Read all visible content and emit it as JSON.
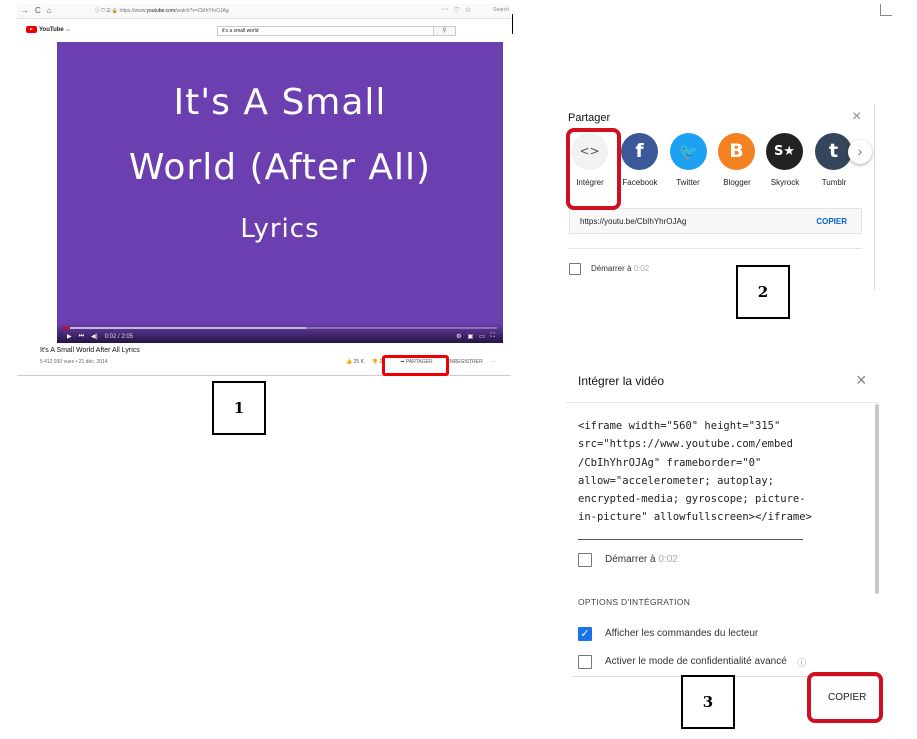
{
  "browser": {
    "nav_icons": [
      "→",
      "C",
      "⌂"
    ],
    "url_prefix": "ⓘ ⛉ ☑ 🔒 https://www.",
    "url_domain": "youtube.com",
    "url_path": "/watch?v=CbIhYhrOJAg",
    "toolbar_icons": [
      "···",
      "♡",
      "☆"
    ],
    "search_placeholder": "Search"
  },
  "youtube": {
    "logo_text": "YouTube",
    "logo_region": "FR",
    "search_value": "it's a small world",
    "video": {
      "line1": "It's A Small",
      "line2": "World (After All)",
      "line3": "Lyrics",
      "time": "0:02 / 2:05",
      "progress_played": 0.016,
      "progress_buffered": 0.56
    },
    "title": "It's A Small World After All Lyrics",
    "meta": "5 412 930 vues • 21 déc. 2014",
    "actions": {
      "like": "25 K",
      "dislike": "2",
      "share": "PARTAGER",
      "save": "ENREGISTRER",
      "more": "···"
    }
  },
  "labels": {
    "one": "1",
    "two": "2",
    "three": "3"
  },
  "share": {
    "title": "Partager",
    "close": "×",
    "items": [
      {
        "label": "Intégrer",
        "icon": "embed-icon",
        "glyph": "<>",
        "color": "#f2f2f2"
      },
      {
        "label": "Facebook",
        "icon": "facebook-icon",
        "glyph": "f",
        "color": "#3b5998"
      },
      {
        "label": "Twitter",
        "icon": "twitter-icon",
        "glyph": "🐦",
        "color": "#1da1f2"
      },
      {
        "label": "Blogger",
        "icon": "blogger-icon",
        "glyph": "B",
        "color": "#f48120"
      },
      {
        "label": "Skyrock",
        "icon": "skyrock-icon",
        "glyph": "S★",
        "color": "#222222"
      },
      {
        "label": "Tumblr",
        "icon": "tumblr-icon",
        "glyph": "t",
        "color": "#35465c"
      }
    ],
    "next": "›",
    "url": "https://youtu.be/CbIhYhrOJAg",
    "copy": "COPIER",
    "start_label": "Démarrer à",
    "start_time": "0:02"
  },
  "embed": {
    "title": "Intégrer la vidéo",
    "close": "×",
    "code": "<iframe width=\"560\" height=\"315\"\nsrc=\"https://www.youtube.com/embed\n/CbIhYhrOJAg\" frameborder=\"0\"\nallow=\"accelerometer; autoplay;\nencrypted-media; gyroscope; picture-\nin-picture\" allowfullscreen></iframe>",
    "start_label": "Démarrer à",
    "start_time": "0:02",
    "options_heading": "OPTIONS D'INTÉGRATION",
    "option1": "Afficher les commandes du lecteur",
    "option1_checked": true,
    "option2": "Activer le mode de confidentialité avancé",
    "option2_checked": false,
    "info": "ⓘ",
    "copy": "COPIER"
  }
}
